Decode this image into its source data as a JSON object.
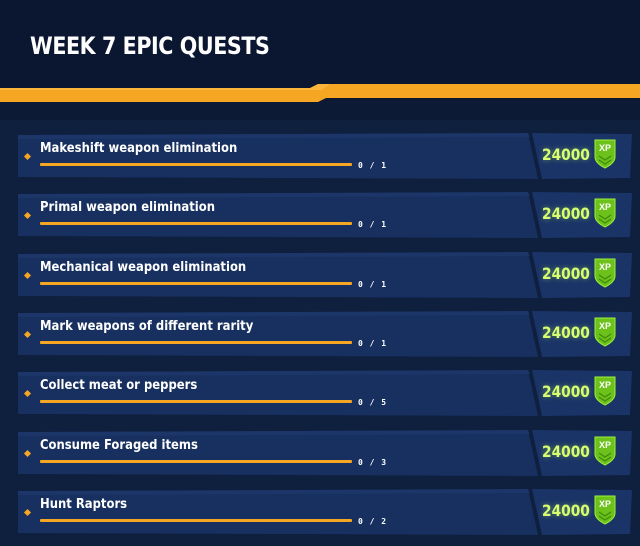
{
  "header": {
    "title": "WEEK 7 EPIC QUESTS"
  },
  "colors": {
    "accent": "#f5a623",
    "background": "#0d1a35",
    "row": "#183060",
    "reward": "#d8ff70",
    "badge": "#6cc21a"
  },
  "quests": [
    {
      "name": "Makeshift weapon elimination",
      "progress_text": "0/1",
      "progress_fraction": 0,
      "reward": "24000",
      "badge": "XP"
    },
    {
      "name": "Primal weapon elimination",
      "progress_text": "0/1",
      "progress_fraction": 0,
      "reward": "24000",
      "badge": "XP"
    },
    {
      "name": "Mechanical weapon elimination",
      "progress_text": "0/1",
      "progress_fraction": 0,
      "reward": "24000",
      "badge": "XP"
    },
    {
      "name": "Mark weapons of different rarity",
      "progress_text": "0/1",
      "progress_fraction": 0,
      "reward": "24000",
      "badge": "XP"
    },
    {
      "name": "Collect meat or peppers",
      "progress_text": "0/5",
      "progress_fraction": 0,
      "reward": "24000",
      "badge": "XP"
    },
    {
      "name": "Consume Foraged items",
      "progress_text": "0/3",
      "progress_fraction": 0,
      "reward": "24000",
      "badge": "XP"
    },
    {
      "name": "Hunt Raptors",
      "progress_text": "0/2",
      "progress_fraction": 0,
      "reward": "24000",
      "badge": "XP"
    }
  ]
}
